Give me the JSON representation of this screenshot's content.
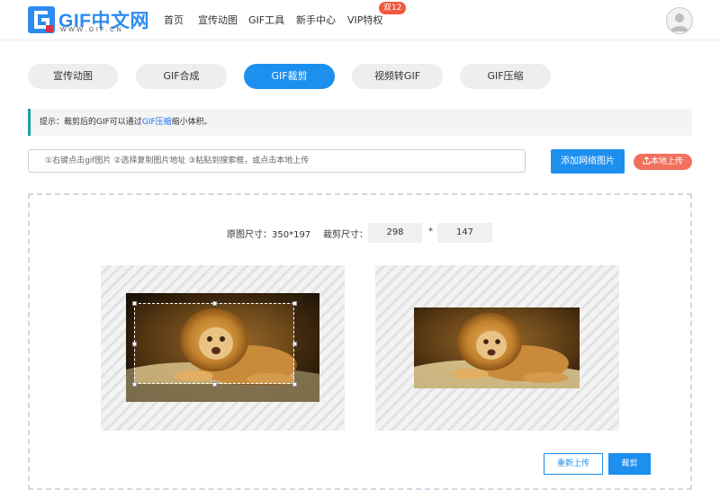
{
  "header": {
    "logo_text": "GIF中文网",
    "logo_sub": "WWW.GIF.CN",
    "nav": [
      {
        "label": "首页"
      },
      {
        "label": "宣传动图"
      },
      {
        "label": "GIF工具"
      },
      {
        "label": "新手中心"
      },
      {
        "label": "VIP特权"
      }
    ],
    "vip_badge": "双12"
  },
  "tabs": [
    {
      "label": "宣传动图",
      "active": false
    },
    {
      "label": "GIF合成",
      "active": false
    },
    {
      "label": "GIF裁剪",
      "active": true
    },
    {
      "label": "视频转GIF",
      "active": false
    },
    {
      "label": "GIF压缩",
      "active": false
    }
  ],
  "tip": {
    "prefix": "提示：裁剪后的GIF可以通过",
    "link": "GIF压缩",
    "suffix": "缩小体积。"
  },
  "upload": {
    "placeholder": "①右键点击gif图片 ②选择复制图片地址 ③粘贴到搜索框，或点击本地上传",
    "add_button": "添加网络图片",
    "local_button": "本地上传"
  },
  "crop": {
    "original_label": "原图尺寸：350*197",
    "crop_label": "裁剪尺寸：",
    "width": "298",
    "separator": "*",
    "height": "147"
  },
  "actions": {
    "reupload": "重新上传",
    "crop": "裁剪"
  },
  "colors": {
    "accent": "#1c8fef",
    "upload_button": "#f1705e",
    "vip_badge": "#f0583c",
    "tip_border": "#1aa0a0"
  },
  "icons": [
    "gif-logo-icon",
    "user-avatar-icon",
    "upload-icon"
  ]
}
